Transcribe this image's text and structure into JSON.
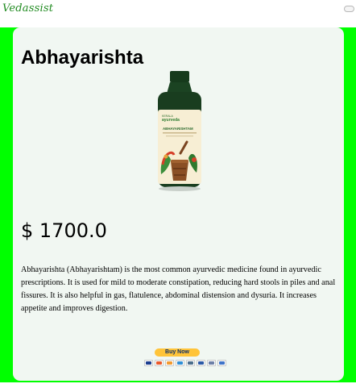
{
  "header": {
    "brand": "Vedassist"
  },
  "product": {
    "title": "Abhayarishta",
    "price": "$ 1700.0",
    "description": "Abhayarishta (Abhayarishtam) is the most common ayurvedic medicine found in ayurvedic prescriptions. It is used for mild to moderate constipation, reducing hard stools in piles and anal fissures. It is also helpful in gas, flatulence, abdominal distension and dysuria. It increases appetite and improves digestion.",
    "image": {
      "brand_top": "KERALA",
      "brand_name": "ayurveda",
      "label_name": "ABHAYARISHTAM"
    }
  },
  "checkout": {
    "buy_label": "Buy Now",
    "card_icons": [
      "visa-icon",
      "mastercard-icon",
      "discover-icon",
      "amex-icon",
      "bank-icon",
      "paypal-icon",
      "card-icon",
      "card-icon"
    ]
  },
  "colors": {
    "frame": "#00ff00",
    "card_bg": "#f1f7f2",
    "brand": "#1f8a1f",
    "buy_button": "#ffc439"
  }
}
